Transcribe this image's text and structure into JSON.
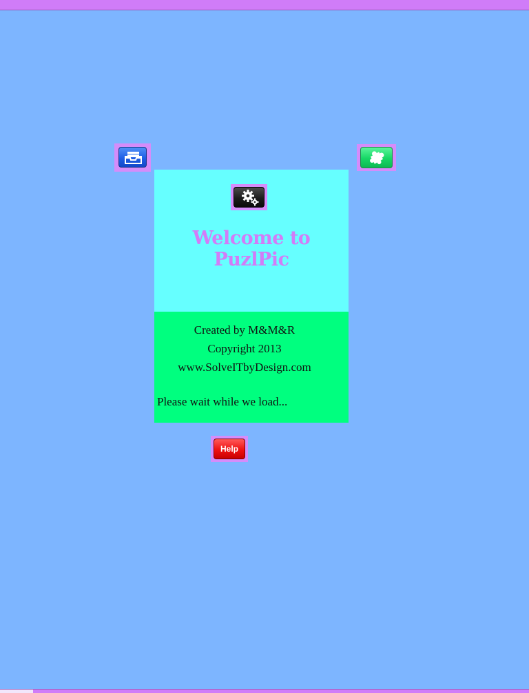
{
  "app": {
    "welcome_title": "Welcome to PuzlPic"
  },
  "credits": {
    "line1": "Created by M&M&R",
    "line2": "Copyright 2013",
    "line3": "www.SolveITbyDesign.com"
  },
  "status": {
    "loading_text": "Please wait while we load..."
  },
  "buttons": {
    "help_label": "Help",
    "archive_icon": "inbox-tray-icon",
    "puzzle_icon": "puzzle-piece-icon",
    "settings_icon": "gears-icon"
  },
  "colors": {
    "background": "#7db5ff",
    "bars": "#d07cf8",
    "panel_top": "#66ffff",
    "panel_bottom": "#00ff7f",
    "title_text": "#d27cf7"
  }
}
